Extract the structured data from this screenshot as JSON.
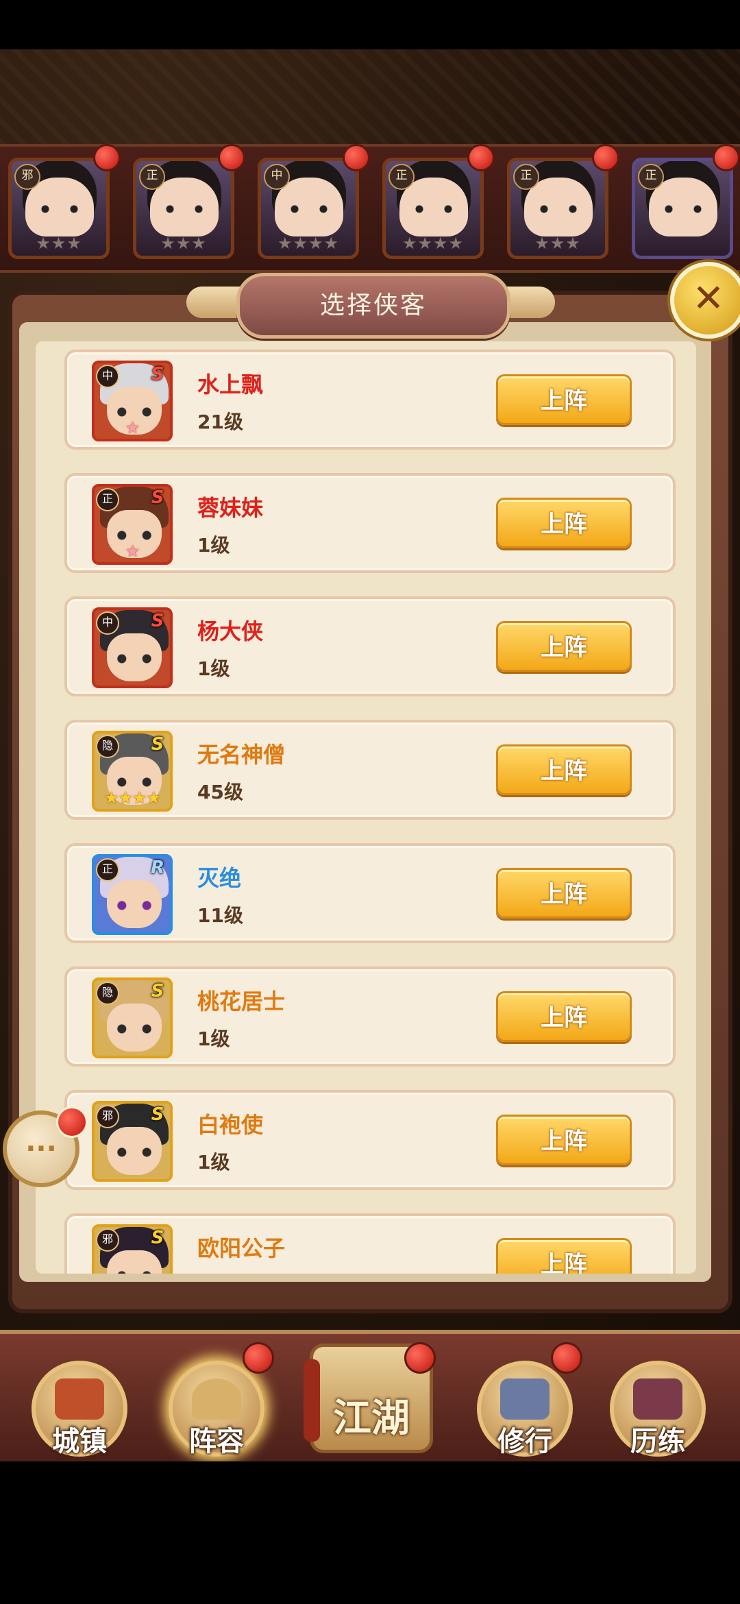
{
  "panel": {
    "title": "选择侠客"
  },
  "close_button": {
    "icon": "close-icon"
  },
  "roster": [
    {
      "faction": "邪",
      "stars": "★★★",
      "frame": "#7a3a18"
    },
    {
      "faction": "正",
      "stars": "★★★",
      "frame": "#7a3a18"
    },
    {
      "faction": "中",
      "stars": "★★★★",
      "frame": "#7a3a18"
    },
    {
      "faction": "正",
      "stars": "★★★★",
      "frame": "#7a3a18"
    },
    {
      "faction": "正",
      "stars": "★★★",
      "frame": "#7a3a18"
    },
    {
      "faction": "正",
      "stars": "",
      "frame": "#5a4a8a"
    }
  ],
  "heroes": [
    {
      "name": "水上飘",
      "level": "21级",
      "faction": "中",
      "grade": "S",
      "stars": "★",
      "name_color": "#e0201a",
      "frame": "#c0301c",
      "hair": "#d8d8dc",
      "button": "上阵"
    },
    {
      "name": "蓉妹妹",
      "level": "1级",
      "faction": "正",
      "grade": "S",
      "stars": "★",
      "name_color": "#e0201a",
      "frame": "#c0301c",
      "hair": "#6a3320",
      "button": "上阵"
    },
    {
      "name": "杨大侠",
      "level": "1级",
      "faction": "中",
      "grade": "S",
      "stars": "",
      "name_color": "#e0201a",
      "frame": "#c0301c",
      "hair": "#2e2a30",
      "button": "上阵"
    },
    {
      "name": "无名神僧",
      "level": "45级",
      "faction": "隐",
      "grade": "S",
      "stars": "★★★★",
      "name_color": "#e07a10",
      "frame": "#e0a21a",
      "hair": "#5a5a5a",
      "button": "上阵"
    },
    {
      "name": "灭绝",
      "level": "11级",
      "faction": "正",
      "grade": "R",
      "stars": "",
      "name_color": "#2a8ee0",
      "frame": "#2a8ee0",
      "hair": "#d8d0e8",
      "button": "上阵"
    },
    {
      "name": "桃花居士",
      "level": "1级",
      "faction": "隐",
      "grade": "S",
      "stars": "",
      "name_color": "#e07a10",
      "frame": "#e0a21a",
      "hair": "#d8b070",
      "button": "上阵"
    },
    {
      "name": "白袍使",
      "level": "1级",
      "faction": "邪",
      "grade": "S",
      "stars": "",
      "name_color": "#e07a10",
      "frame": "#e0a21a",
      "hair": "#2a2a2a",
      "button": "上阵"
    },
    {
      "name": "欧阳公子",
      "level": "",
      "faction": "邪",
      "grade": "S",
      "stars": "",
      "name_color": "#e07a10",
      "frame": "#e0a21a",
      "hair": "#2a2030",
      "button": "上阵"
    }
  ],
  "chat": {
    "icon": "chat-bubble-icon",
    "glyph": "···"
  },
  "nav": [
    {
      "label": "城镇",
      "icon": "town-icon",
      "color": "#c0502a"
    },
    {
      "label": "阵容",
      "icon": "lineup-icon",
      "color": "#d8b06a"
    },
    {
      "label": "江湖",
      "icon": "jianghu-scroll-icon",
      "color": "#b98a4a"
    },
    {
      "label": "修行",
      "icon": "cultivation-icon",
      "color": "#6a7aa0"
    },
    {
      "label": "历练",
      "icon": "training-icon",
      "color": "#7a3a4a"
    }
  ]
}
